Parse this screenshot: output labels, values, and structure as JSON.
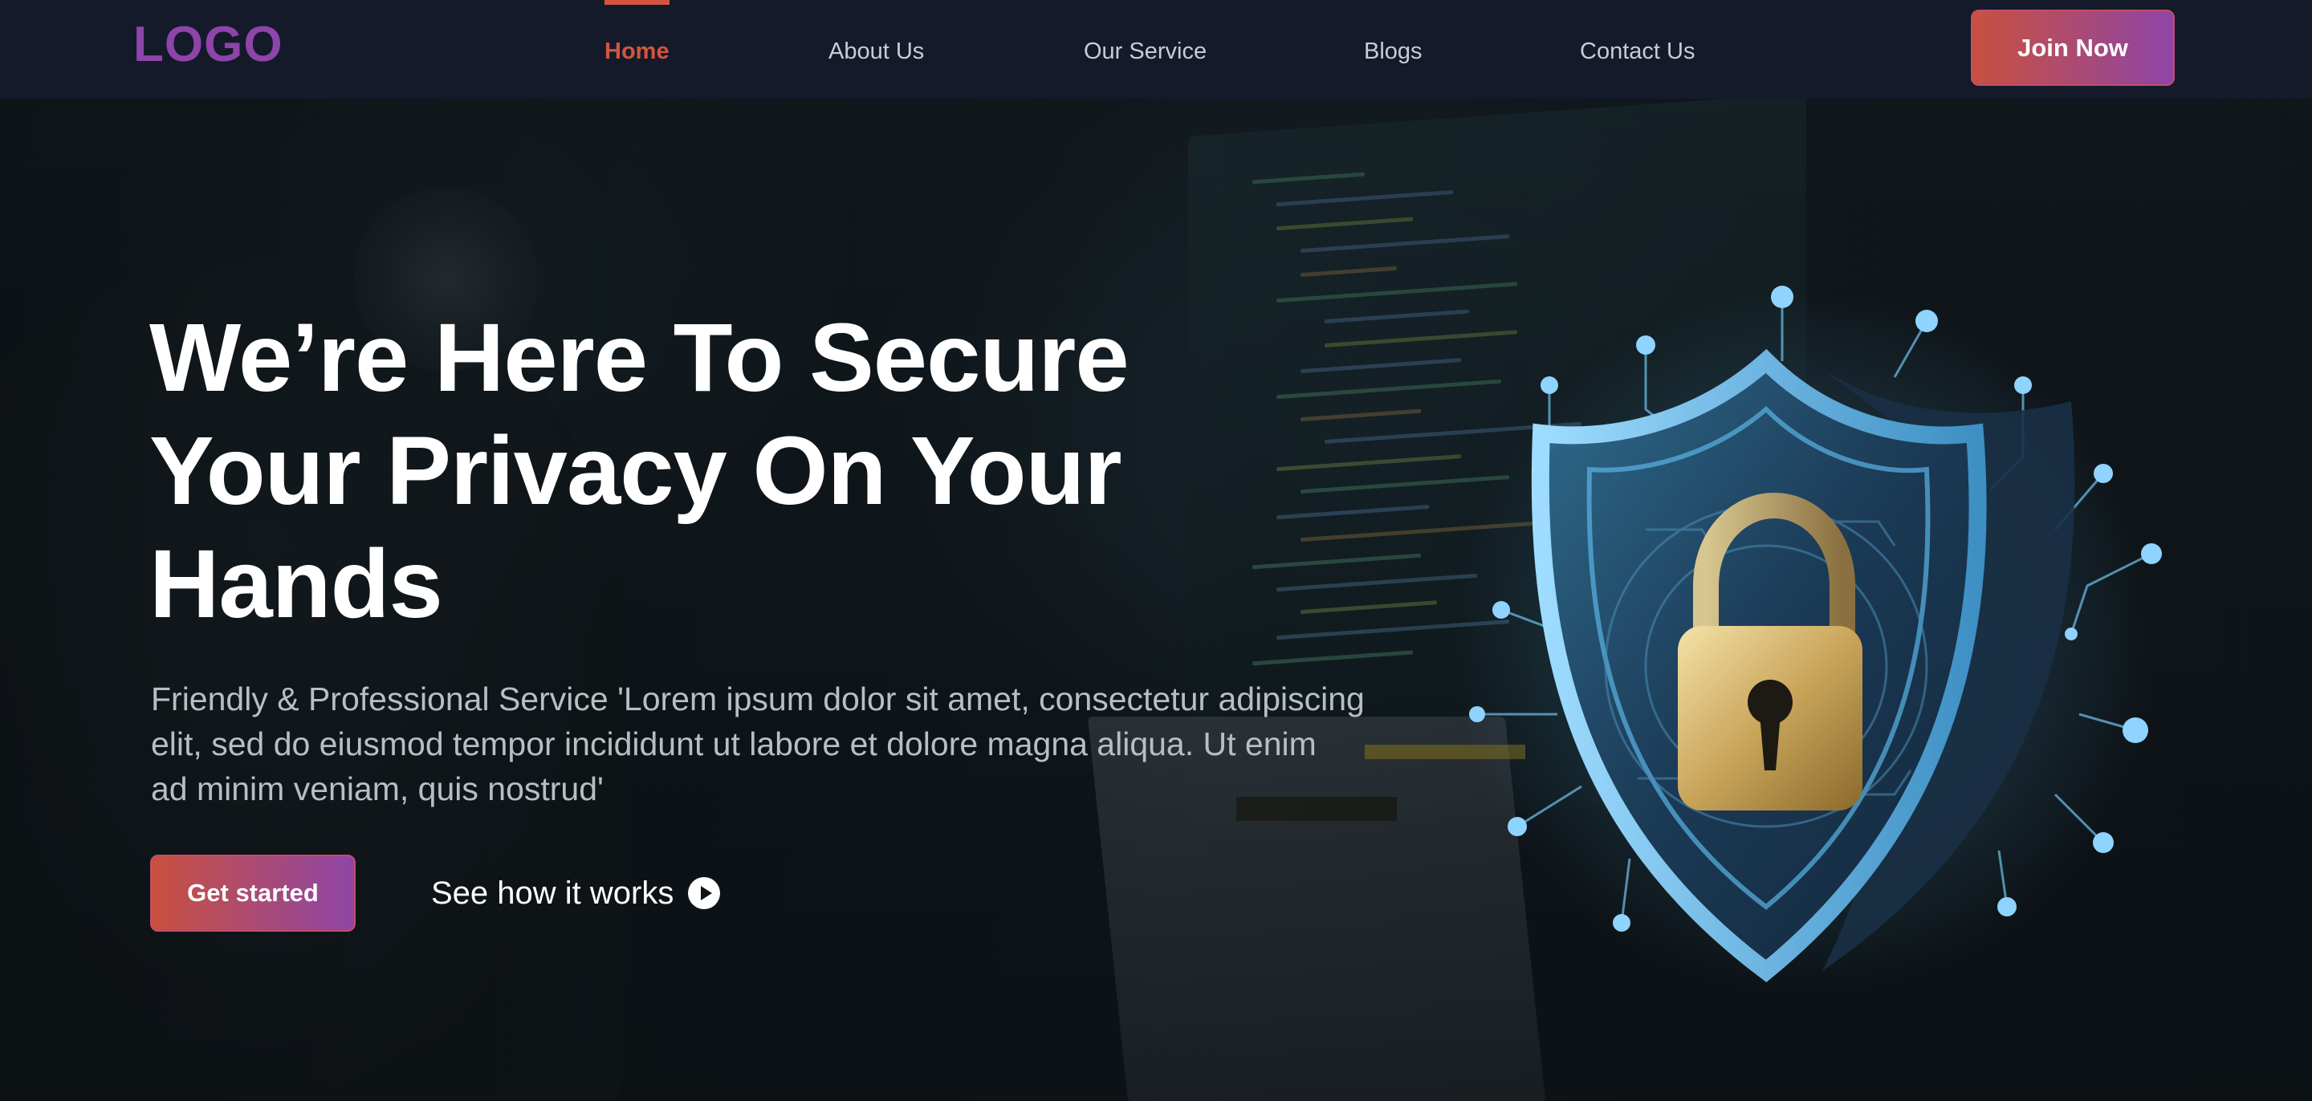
{
  "header": {
    "logo": "LOGO",
    "nav": [
      {
        "label": "Home",
        "active": true
      },
      {
        "label": "About Us",
        "active": false
      },
      {
        "label": "Our Service",
        "active": false
      },
      {
        "label": "Blogs",
        "active": false
      },
      {
        "label": "Contact Us",
        "active": false
      }
    ],
    "join_label": "Join Now"
  },
  "hero": {
    "title_lines": [
      "We’re Here To Secure",
      "Your Privacy On Your",
      "Hands"
    ],
    "description_lines": [
      "Friendly & Professional Service 'Lorem ipsum dolor sit amet, consectetur adipiscing",
      "elit, sed do eiusmod tempor incididunt ut labore et dolore magna aliqua. Ut enim",
      "ad minim veniam, quis nostrud'"
    ],
    "primary_cta": "Get started",
    "secondary_cta": "See how it works"
  },
  "colors": {
    "header_bg": "#141a2a",
    "logo": "#8e44a8",
    "active_nav": "#d4553e",
    "gradient_start": "#c9503e",
    "gradient_end": "#8e45a6",
    "shield_glow": "#5ab4e6"
  },
  "icons": {
    "play": "play-circle-icon",
    "illustration": "shield-lock-icon"
  }
}
